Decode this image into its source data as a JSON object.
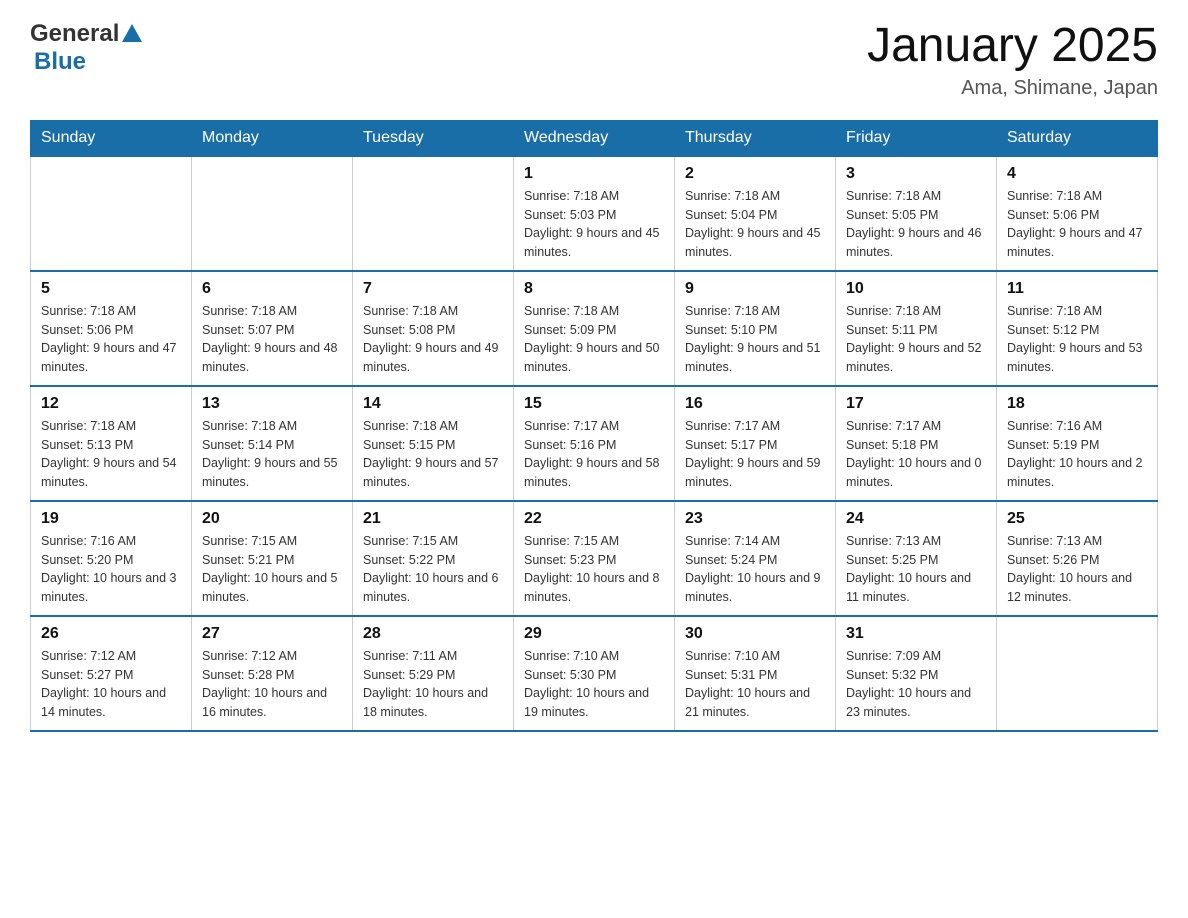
{
  "header": {
    "logo": {
      "text_general": "General",
      "text_blue": "Blue"
    },
    "title": "January 2025",
    "location": "Ama, Shimane, Japan"
  },
  "days_of_week": [
    "Sunday",
    "Monday",
    "Tuesday",
    "Wednesday",
    "Thursday",
    "Friday",
    "Saturday"
  ],
  "weeks": [
    [
      {
        "day": "",
        "sunrise": "",
        "sunset": "",
        "daylight": ""
      },
      {
        "day": "",
        "sunrise": "",
        "sunset": "",
        "daylight": ""
      },
      {
        "day": "",
        "sunrise": "",
        "sunset": "",
        "daylight": ""
      },
      {
        "day": "1",
        "sunrise": "Sunrise: 7:18 AM",
        "sunset": "Sunset: 5:03 PM",
        "daylight": "Daylight: 9 hours and 45 minutes."
      },
      {
        "day": "2",
        "sunrise": "Sunrise: 7:18 AM",
        "sunset": "Sunset: 5:04 PM",
        "daylight": "Daylight: 9 hours and 45 minutes."
      },
      {
        "day": "3",
        "sunrise": "Sunrise: 7:18 AM",
        "sunset": "Sunset: 5:05 PM",
        "daylight": "Daylight: 9 hours and 46 minutes."
      },
      {
        "day": "4",
        "sunrise": "Sunrise: 7:18 AM",
        "sunset": "Sunset: 5:06 PM",
        "daylight": "Daylight: 9 hours and 47 minutes."
      }
    ],
    [
      {
        "day": "5",
        "sunrise": "Sunrise: 7:18 AM",
        "sunset": "Sunset: 5:06 PM",
        "daylight": "Daylight: 9 hours and 47 minutes."
      },
      {
        "day": "6",
        "sunrise": "Sunrise: 7:18 AM",
        "sunset": "Sunset: 5:07 PM",
        "daylight": "Daylight: 9 hours and 48 minutes."
      },
      {
        "day": "7",
        "sunrise": "Sunrise: 7:18 AM",
        "sunset": "Sunset: 5:08 PM",
        "daylight": "Daylight: 9 hours and 49 minutes."
      },
      {
        "day": "8",
        "sunrise": "Sunrise: 7:18 AM",
        "sunset": "Sunset: 5:09 PM",
        "daylight": "Daylight: 9 hours and 50 minutes."
      },
      {
        "day": "9",
        "sunrise": "Sunrise: 7:18 AM",
        "sunset": "Sunset: 5:10 PM",
        "daylight": "Daylight: 9 hours and 51 minutes."
      },
      {
        "day": "10",
        "sunrise": "Sunrise: 7:18 AM",
        "sunset": "Sunset: 5:11 PM",
        "daylight": "Daylight: 9 hours and 52 minutes."
      },
      {
        "day": "11",
        "sunrise": "Sunrise: 7:18 AM",
        "sunset": "Sunset: 5:12 PM",
        "daylight": "Daylight: 9 hours and 53 minutes."
      }
    ],
    [
      {
        "day": "12",
        "sunrise": "Sunrise: 7:18 AM",
        "sunset": "Sunset: 5:13 PM",
        "daylight": "Daylight: 9 hours and 54 minutes."
      },
      {
        "day": "13",
        "sunrise": "Sunrise: 7:18 AM",
        "sunset": "Sunset: 5:14 PM",
        "daylight": "Daylight: 9 hours and 55 minutes."
      },
      {
        "day": "14",
        "sunrise": "Sunrise: 7:18 AM",
        "sunset": "Sunset: 5:15 PM",
        "daylight": "Daylight: 9 hours and 57 minutes."
      },
      {
        "day": "15",
        "sunrise": "Sunrise: 7:17 AM",
        "sunset": "Sunset: 5:16 PM",
        "daylight": "Daylight: 9 hours and 58 minutes."
      },
      {
        "day": "16",
        "sunrise": "Sunrise: 7:17 AM",
        "sunset": "Sunset: 5:17 PM",
        "daylight": "Daylight: 9 hours and 59 minutes."
      },
      {
        "day": "17",
        "sunrise": "Sunrise: 7:17 AM",
        "sunset": "Sunset: 5:18 PM",
        "daylight": "Daylight: 10 hours and 0 minutes."
      },
      {
        "day": "18",
        "sunrise": "Sunrise: 7:16 AM",
        "sunset": "Sunset: 5:19 PM",
        "daylight": "Daylight: 10 hours and 2 minutes."
      }
    ],
    [
      {
        "day": "19",
        "sunrise": "Sunrise: 7:16 AM",
        "sunset": "Sunset: 5:20 PM",
        "daylight": "Daylight: 10 hours and 3 minutes."
      },
      {
        "day": "20",
        "sunrise": "Sunrise: 7:15 AM",
        "sunset": "Sunset: 5:21 PM",
        "daylight": "Daylight: 10 hours and 5 minutes."
      },
      {
        "day": "21",
        "sunrise": "Sunrise: 7:15 AM",
        "sunset": "Sunset: 5:22 PM",
        "daylight": "Daylight: 10 hours and 6 minutes."
      },
      {
        "day": "22",
        "sunrise": "Sunrise: 7:15 AM",
        "sunset": "Sunset: 5:23 PM",
        "daylight": "Daylight: 10 hours and 8 minutes."
      },
      {
        "day": "23",
        "sunrise": "Sunrise: 7:14 AM",
        "sunset": "Sunset: 5:24 PM",
        "daylight": "Daylight: 10 hours and 9 minutes."
      },
      {
        "day": "24",
        "sunrise": "Sunrise: 7:13 AM",
        "sunset": "Sunset: 5:25 PM",
        "daylight": "Daylight: 10 hours and 11 minutes."
      },
      {
        "day": "25",
        "sunrise": "Sunrise: 7:13 AM",
        "sunset": "Sunset: 5:26 PM",
        "daylight": "Daylight: 10 hours and 12 minutes."
      }
    ],
    [
      {
        "day": "26",
        "sunrise": "Sunrise: 7:12 AM",
        "sunset": "Sunset: 5:27 PM",
        "daylight": "Daylight: 10 hours and 14 minutes."
      },
      {
        "day": "27",
        "sunrise": "Sunrise: 7:12 AM",
        "sunset": "Sunset: 5:28 PM",
        "daylight": "Daylight: 10 hours and 16 minutes."
      },
      {
        "day": "28",
        "sunrise": "Sunrise: 7:11 AM",
        "sunset": "Sunset: 5:29 PM",
        "daylight": "Daylight: 10 hours and 18 minutes."
      },
      {
        "day": "29",
        "sunrise": "Sunrise: 7:10 AM",
        "sunset": "Sunset: 5:30 PM",
        "daylight": "Daylight: 10 hours and 19 minutes."
      },
      {
        "day": "30",
        "sunrise": "Sunrise: 7:10 AM",
        "sunset": "Sunset: 5:31 PM",
        "daylight": "Daylight: 10 hours and 21 minutes."
      },
      {
        "day": "31",
        "sunrise": "Sunrise: 7:09 AM",
        "sunset": "Sunset: 5:32 PM",
        "daylight": "Daylight: 10 hours and 23 minutes."
      },
      {
        "day": "",
        "sunrise": "",
        "sunset": "",
        "daylight": ""
      }
    ]
  ]
}
